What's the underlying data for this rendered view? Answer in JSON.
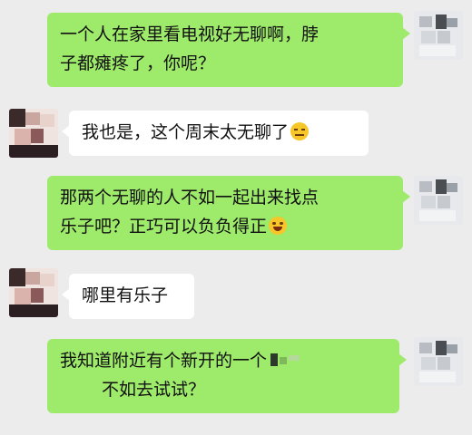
{
  "messages": [
    {
      "side": "right",
      "lines": [
        "一个人在家里看电视好无聊啊，脖",
        "子都瘫疼了，你呢？"
      ]
    },
    {
      "side": "left",
      "lines": [
        "我也是，这个周末太无聊了"
      ],
      "emoji": "neutral-face-icon"
    },
    {
      "side": "right",
      "lines": [
        "那两个无聊的人不如一起出来找点",
        "乐子吧？正巧可以负负得正"
      ],
      "emoji": "laughing-face-icon"
    },
    {
      "side": "left",
      "lines": [
        "哪里有乐子"
      ]
    },
    {
      "side": "right",
      "lines": [
        "我知道附近有个新开的一个",
        "不如去试试？"
      ],
      "redacted": true
    }
  ],
  "colors": {
    "background": "#ececec",
    "outgoing_bubble": "#9eea6a",
    "incoming_bubble": "#ffffff"
  }
}
